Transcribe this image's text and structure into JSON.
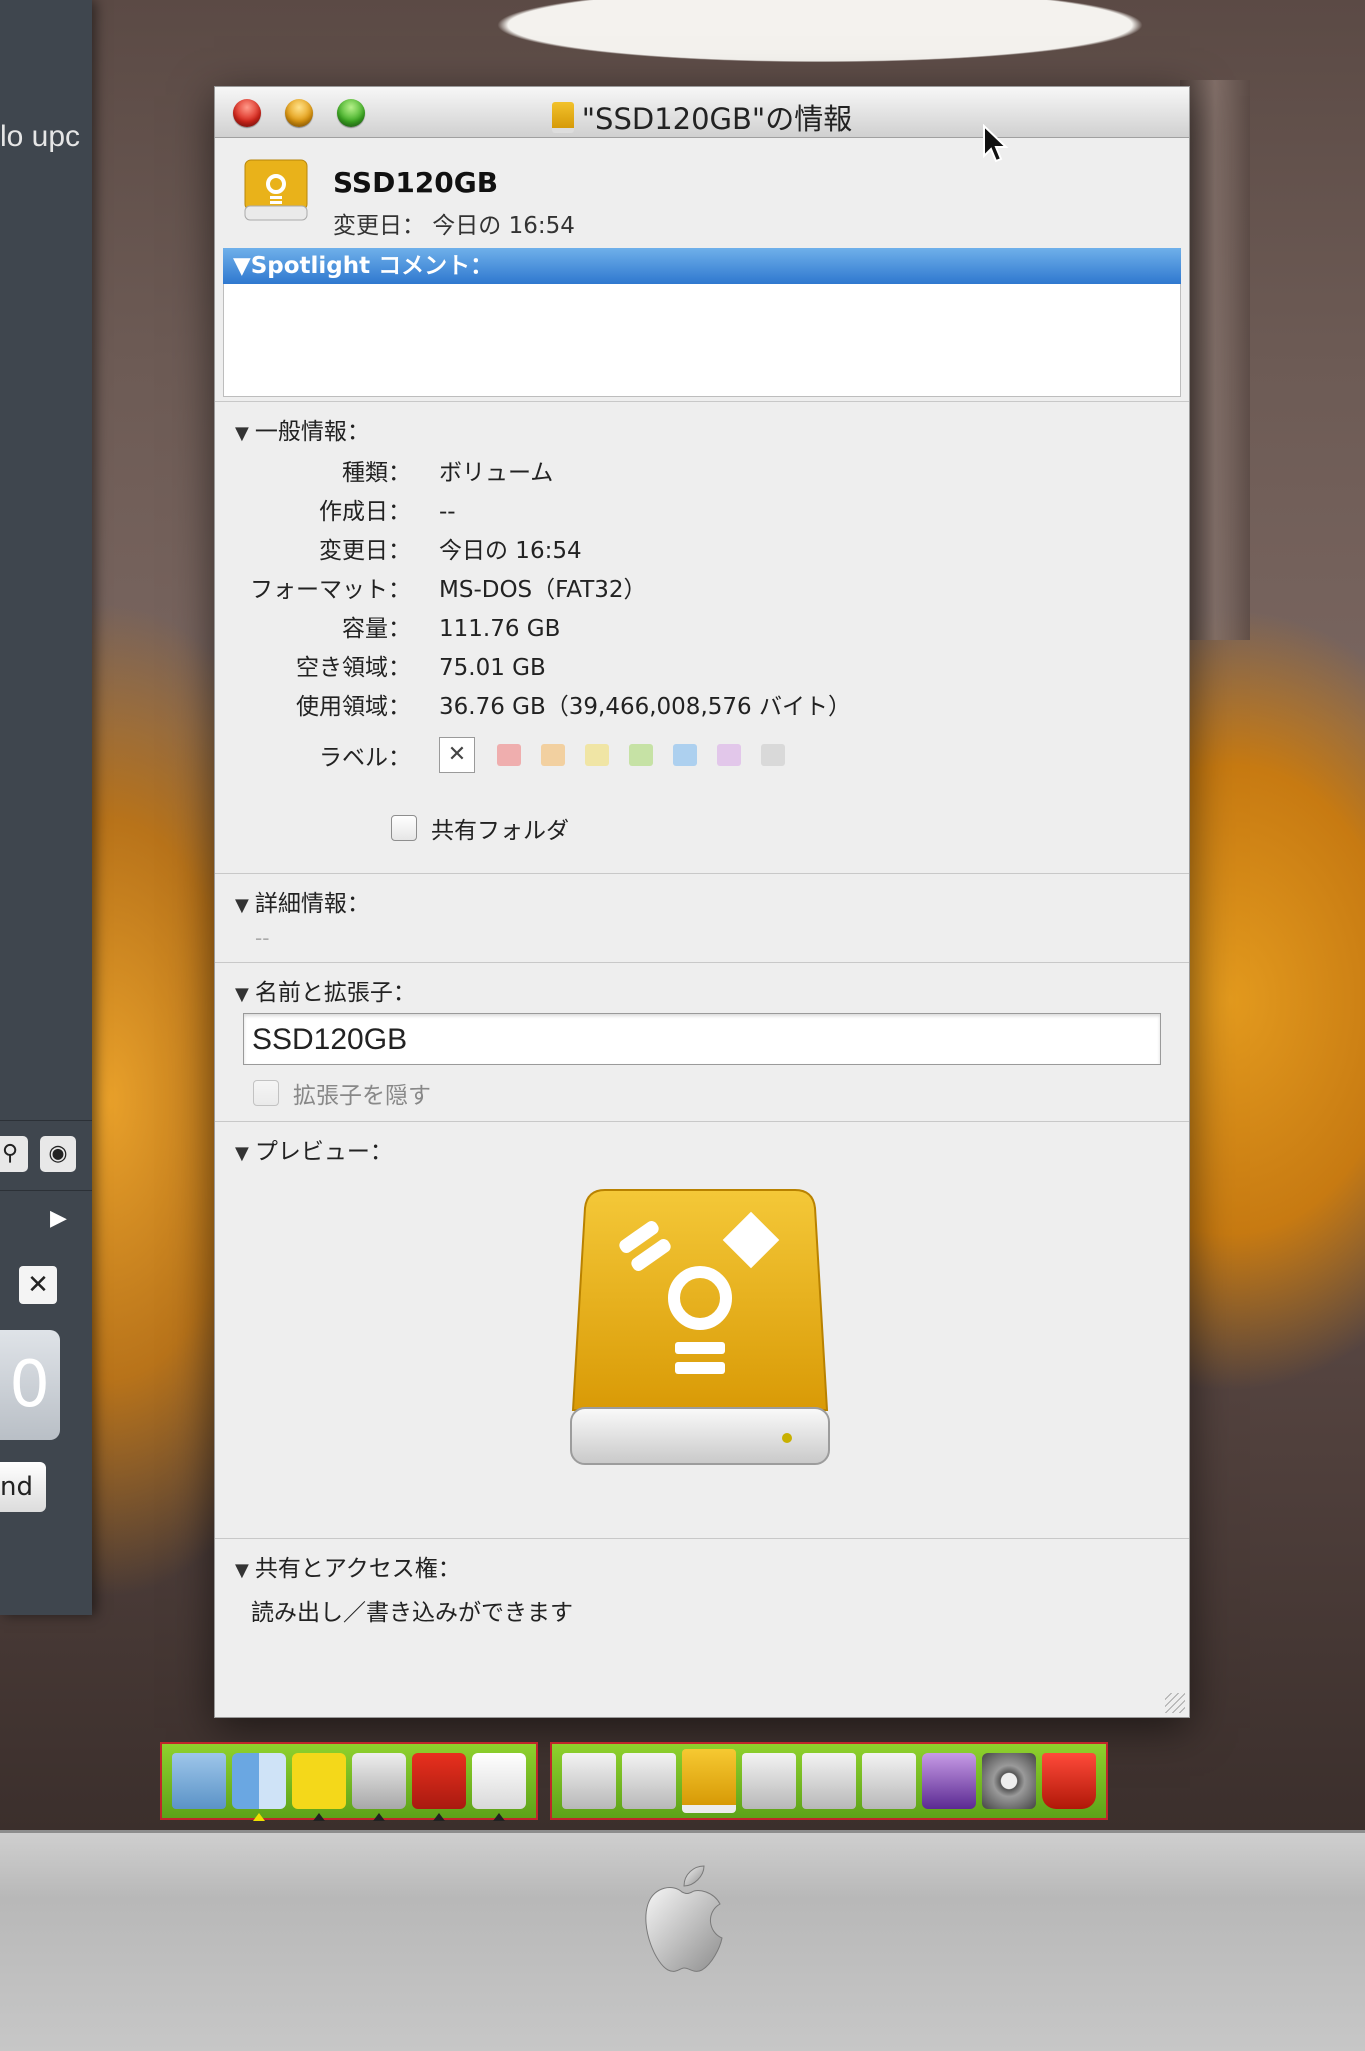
{
  "background_window": {
    "text_fragment": "lo upc",
    "nd_button_label": "nd",
    "digit_fragment": "0"
  },
  "window": {
    "title": "\"SSD120GB\"の情報",
    "name": "SSD120GB",
    "modified_line": "変更日： 今日の 16:54"
  },
  "spotlight": {
    "header": "▼Spotlight コメント："
  },
  "general": {
    "header": "一般情報：",
    "rows": [
      {
        "key": "種類：",
        "value": "ボリューム"
      },
      {
        "key": "作成日：",
        "value": "--"
      },
      {
        "key": "変更日：",
        "value": "今日の 16:54"
      },
      {
        "key": "フォーマット：",
        "value": "MS-DOS（FAT32）"
      },
      {
        "key": "容量：",
        "value": "111.76 GB"
      },
      {
        "key": "空き領域：",
        "value": "75.01 GB"
      },
      {
        "key": "使用領域：",
        "value": "36.76 GB（39,466,008,576 バイト）"
      }
    ],
    "label_key": "ラベル：",
    "label_clear": "✕",
    "label_colors": [
      "#f07a7a",
      "#f5b860",
      "#f2de6a",
      "#a6d86a",
      "#78b8f0",
      "#d8a8e8",
      "#c8c8c8"
    ],
    "shared_folder_label": "共有フォルダ"
  },
  "details": {
    "header": "詳細情報：",
    "value": "--"
  },
  "name_ext": {
    "header": "名前と拡張子：",
    "field_value": "SSD120GB",
    "hide_ext_label": "拡張子を隠す"
  },
  "preview": {
    "header": "プレビュー："
  },
  "sharing": {
    "header": "共有とアクセス権：",
    "text": "読み出し／書き込みができます"
  },
  "colors": {
    "spotlight_highlight": "#3d86d6",
    "drive_yellow": "#e9b21a",
    "dock_green": "#75b922",
    "dock_border": "#c0262b"
  },
  "dock": {
    "left_group": [
      "folder-icon",
      "finder-icon",
      "bird-icon",
      "printer-icon",
      "acrobat-icon",
      "blank-document-icon"
    ],
    "right_group": [
      "drive-icon",
      "drive-icon",
      "firewire-drive-icon",
      "drive-icon",
      "drive-icon",
      "drive-icon",
      "purple-app-icon",
      "gear-icon",
      "trash-icon"
    ]
  }
}
